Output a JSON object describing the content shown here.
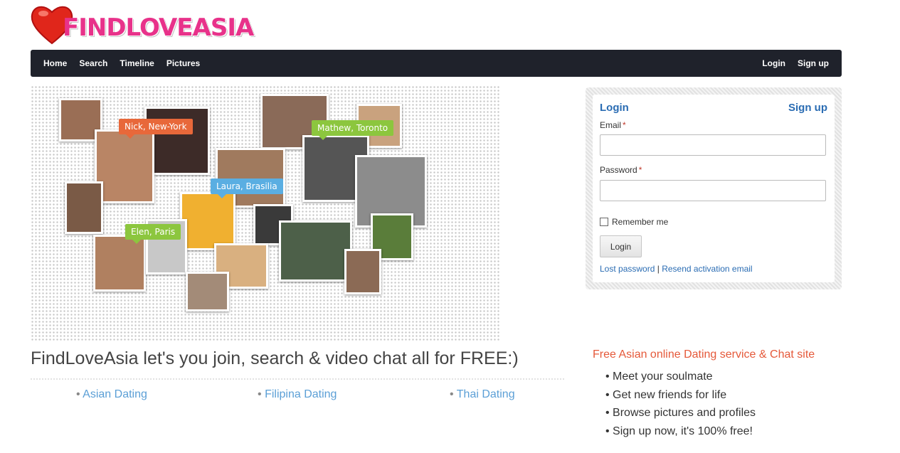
{
  "brand": {
    "name": "FINDLOVEASIA"
  },
  "nav": {
    "left": [
      "Home",
      "Search",
      "Timeline",
      "Pictures"
    ],
    "right": [
      "Login",
      "Sign up"
    ]
  },
  "hero": {
    "tags": [
      {
        "text": "Nick, New-York",
        "color": "#e8683a"
      },
      {
        "text": "Mathew, Toronto",
        "color": "#8cc63e"
      },
      {
        "text": "Laura, Brasilia",
        "color": "#5aaee2"
      },
      {
        "text": "Elen, Paris",
        "color": "#8cc63e"
      }
    ]
  },
  "login": {
    "title": "Login",
    "signup": "Sign up",
    "email_label": "Email",
    "password_label": "Password",
    "required_mark": "*",
    "email_value": "",
    "password_value": "",
    "remember": "Remember me",
    "button": "Login",
    "lost_password": "Lost password",
    "separator": "|",
    "resend": "Resend activation email"
  },
  "main": {
    "tagline": "FindLoveAsia let's you join, search & video chat all for FREE:)",
    "bullet": "•",
    "links": [
      "Asian Dating",
      "Filipina Dating",
      "Thai Dating"
    ]
  },
  "side": {
    "title": "Free Asian online Dating service & Chat site",
    "features": [
      "• Meet your soulmate",
      "• Get new friends for life",
      "• Browse pictures and profiles",
      "• Sign up now, it's 100% free!"
    ]
  },
  "colors": {
    "nav_bg": "#1f222b",
    "link": "#2a6cb3",
    "accent": "#e5593a",
    "brand": "#e8328a"
  }
}
